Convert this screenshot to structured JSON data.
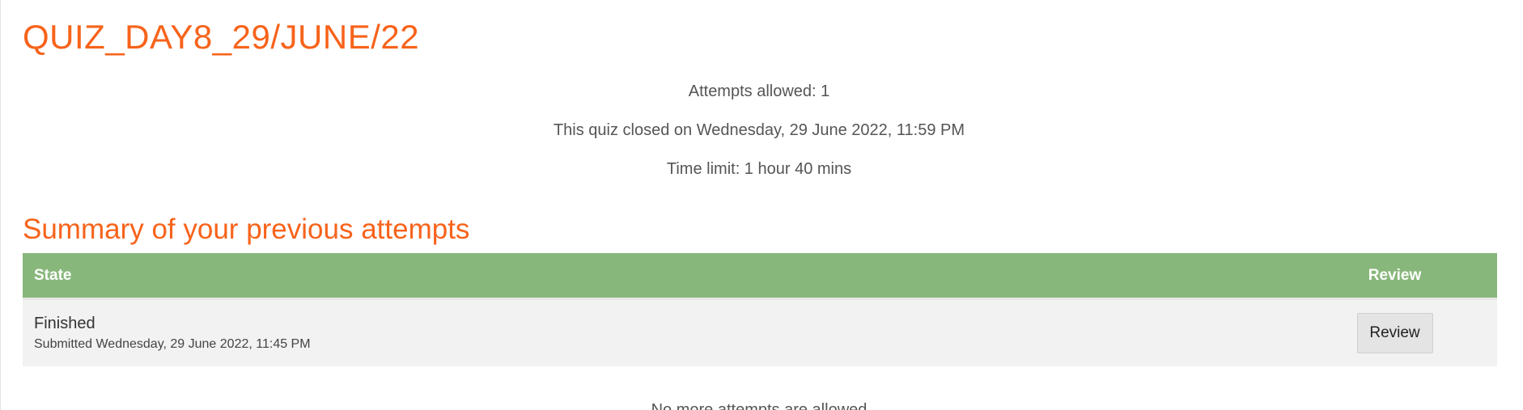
{
  "quiz": {
    "title": "QUIZ_DAY8_29/JUNE/22",
    "attempts_allowed": "Attempts allowed: 1",
    "closed_on": "This quiz closed on Wednesday, 29 June 2022, 11:59 PM",
    "time_limit": "Time limit: 1 hour 40 mins"
  },
  "summary": {
    "title": "Summary of your previous attempts",
    "columns": {
      "state": "State",
      "review": "Review"
    },
    "rows": [
      {
        "state": "Finished",
        "submitted": "Submitted Wednesday, 29 June 2022, 11:45 PM",
        "review_label": "Review"
      }
    ]
  },
  "footer": {
    "message": "No more attempts are allowed"
  },
  "colors": {
    "accent_orange": "#f7631b",
    "table_header_green": "#88b77b",
    "row_background": "#f2f2f2"
  }
}
